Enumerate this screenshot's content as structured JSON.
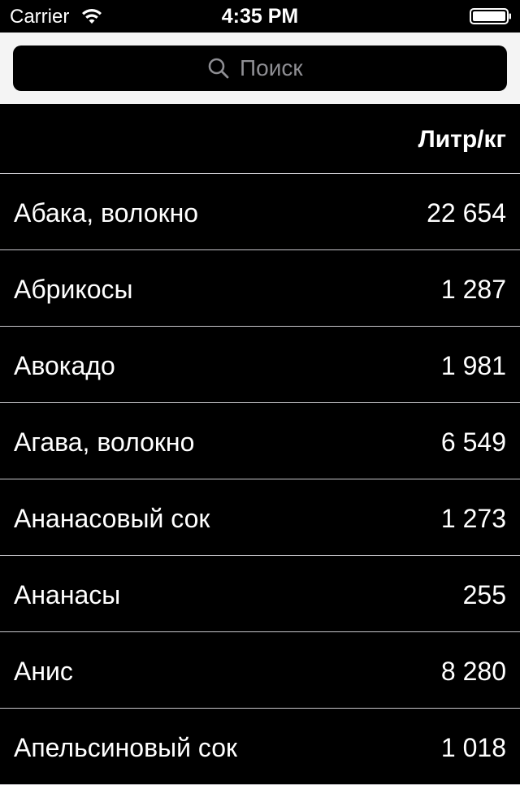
{
  "status_bar": {
    "carrier": "Carrier",
    "time": "4:35 PM"
  },
  "search": {
    "placeholder": "Поиск"
  },
  "table": {
    "column_header": "Литр/кг",
    "rows": [
      {
        "name": "Абака, волокно",
        "value": "22 654"
      },
      {
        "name": "Абрикосы",
        "value": "1 287"
      },
      {
        "name": "Авокадо",
        "value": "1 981"
      },
      {
        "name": "Агава, волокно",
        "value": "6 549"
      },
      {
        "name": "Ананасовый сок",
        "value": "1 273"
      },
      {
        "name": "Ананасы",
        "value": "255"
      },
      {
        "name": "Анис",
        "value": "8 280"
      },
      {
        "name": "Апельсиновый сок",
        "value": "1 018"
      }
    ]
  },
  "colors": {
    "background": "#000000",
    "text": "#ffffff",
    "separator": "#c8c7cc",
    "search_bar_bg": "#f4f4f4",
    "placeholder": "#8e8e93"
  }
}
